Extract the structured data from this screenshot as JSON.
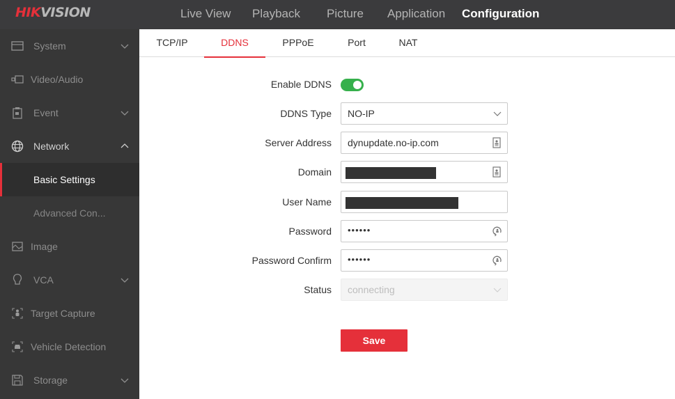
{
  "header": {
    "logo_part1": "HIK",
    "logo_part2": "VISION",
    "nav": [
      {
        "label": "Live View",
        "active": false
      },
      {
        "label": "Playback",
        "active": false
      },
      {
        "label": "Picture",
        "active": false
      },
      {
        "label": "Application",
        "active": false
      },
      {
        "label": "Configuration",
        "active": true
      }
    ]
  },
  "sidebar": {
    "items": [
      {
        "label": "System",
        "icon": "system-icon",
        "expandable": true,
        "expanded": false
      },
      {
        "label": "Video/Audio",
        "icon": "video-audio-icon",
        "expandable": false
      },
      {
        "label": "Event",
        "icon": "event-icon",
        "expandable": true,
        "expanded": false
      },
      {
        "label": "Network",
        "icon": "globe-icon",
        "expandable": true,
        "expanded": true
      },
      {
        "label": "Basic Settings",
        "sub": true,
        "active": true
      },
      {
        "label": "Advanced Con...",
        "sub": true,
        "active": false
      },
      {
        "label": "Image",
        "icon": "image-icon",
        "expandable": false
      },
      {
        "label": "VCA",
        "icon": "lightbulb-icon",
        "expandable": true,
        "expanded": false
      },
      {
        "label": "Target Capture",
        "icon": "target-capture-icon",
        "expandable": false
      },
      {
        "label": "Vehicle Detection",
        "icon": "vehicle-icon",
        "expandable": false
      },
      {
        "label": "Storage",
        "icon": "floppy-disk-icon",
        "expandable": true,
        "expanded": false
      }
    ]
  },
  "tabs": [
    {
      "label": "TCP/IP",
      "active": false
    },
    {
      "label": "DDNS",
      "active": true
    },
    {
      "label": "PPPoE",
      "active": false
    },
    {
      "label": "Port",
      "active": false
    },
    {
      "label": "NAT",
      "active": false
    }
  ],
  "form": {
    "enable_ddns": {
      "label": "Enable DDNS",
      "value": true
    },
    "ddns_type": {
      "label": "DDNS Type",
      "value": "NO-IP"
    },
    "server_address": {
      "label": "Server Address",
      "value": "dynupdate.no-ip.com"
    },
    "domain": {
      "label": "Domain",
      "value": "[redacted]"
    },
    "user_name": {
      "label": "User Name",
      "value": "[redacted]"
    },
    "password": {
      "label": "Password",
      "value": "••••••"
    },
    "password_confirm": {
      "label": "Password Confirm",
      "value": "••••••"
    },
    "status": {
      "label": "Status",
      "value": "connecting"
    },
    "save_label": "Save"
  },
  "colors": {
    "accent": "#e5303a",
    "toggle_on": "#36b04c",
    "topbar": "#3b3b3d",
    "sidebar": "#373737"
  }
}
